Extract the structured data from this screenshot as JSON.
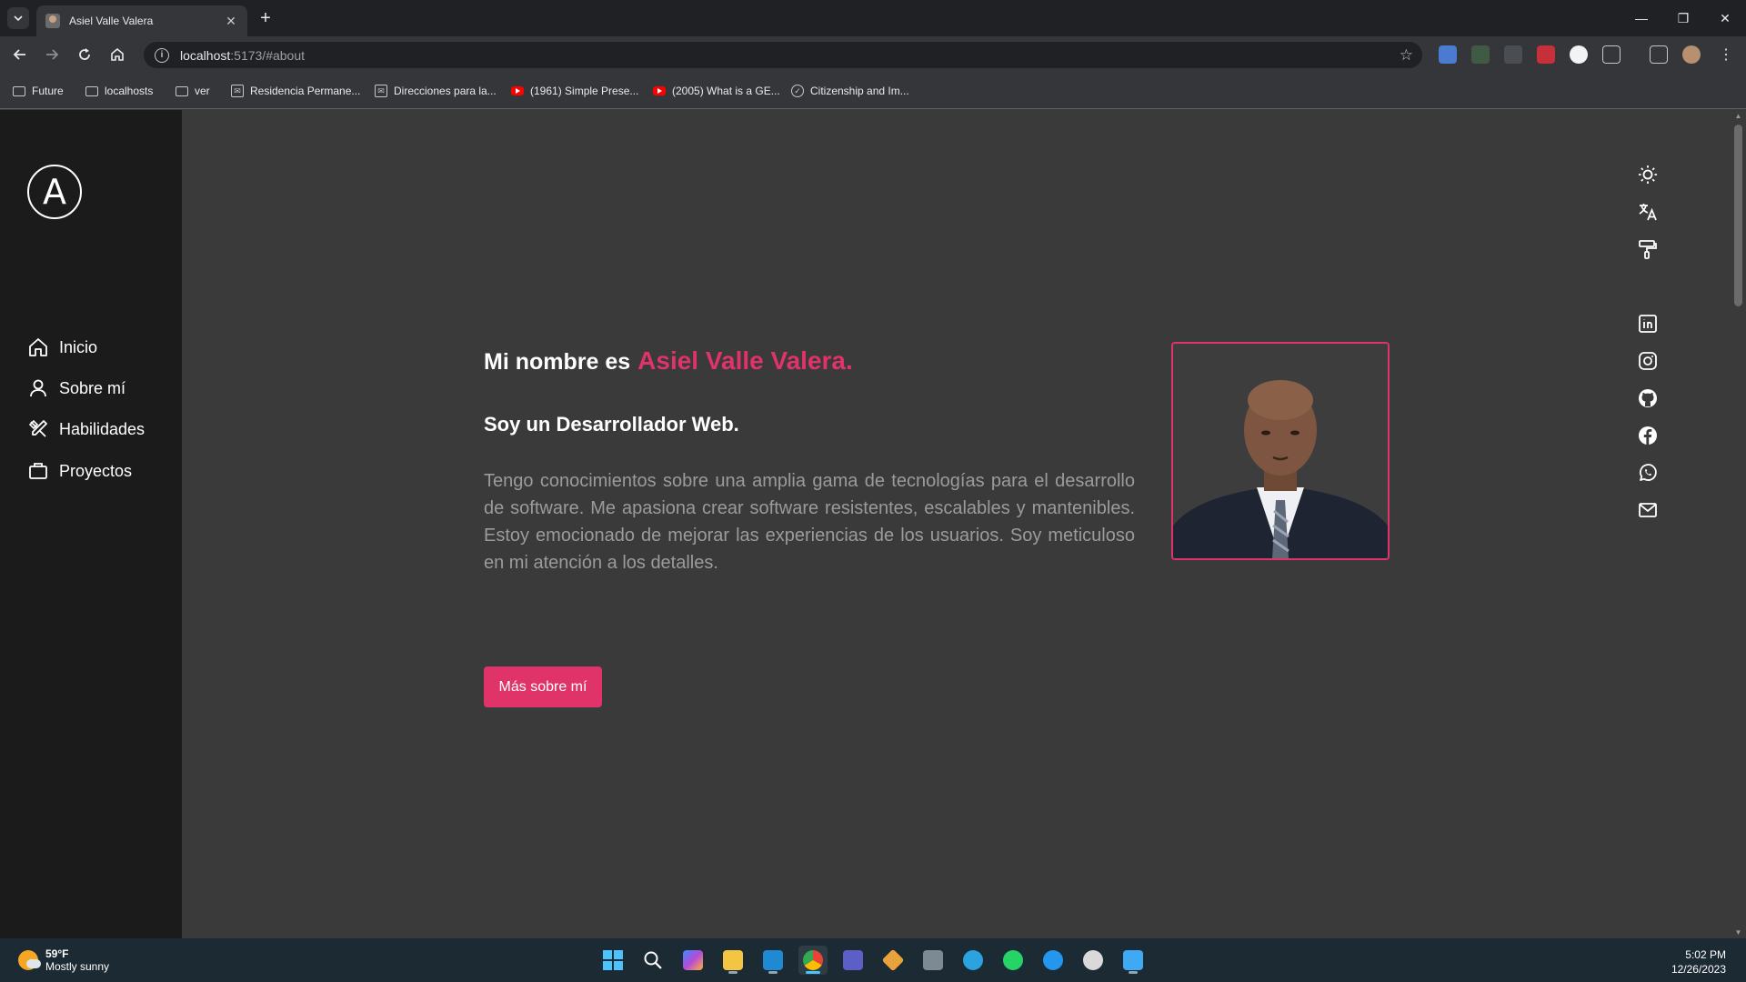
{
  "browser": {
    "tab_title": "Asiel Valle Valera",
    "url_host": "localhost",
    "url_path": ":5173/#about",
    "bookmarks": [
      {
        "label": "Future",
        "icon": "folder-icon"
      },
      {
        "label": "localhosts",
        "icon": "folder-icon"
      },
      {
        "label": "ver",
        "icon": "folder-icon"
      },
      {
        "label": "Residencia Permane...",
        "icon": "gov-site-icon"
      },
      {
        "label": "Direcciones para la...",
        "icon": "gov-site-icon"
      },
      {
        "label": "(1961) Simple Prese...",
        "icon": "youtube-icon"
      },
      {
        "label": "(2005) What is a GE...",
        "icon": "youtube-icon"
      },
      {
        "label": "Citizenship and Im...",
        "icon": "gov-site-icon"
      }
    ]
  },
  "sidebar": {
    "logo_letter": "A",
    "items": [
      {
        "label": "Inicio",
        "icon": "home-icon"
      },
      {
        "label": "Sobre mí",
        "icon": "user-icon"
      },
      {
        "label": "Habilidades",
        "icon": "tools-icon"
      },
      {
        "label": "Proyectos",
        "icon": "briefcase-icon"
      }
    ]
  },
  "about": {
    "intro": "Mi nombre es",
    "name": "Asiel Valle Valera.",
    "subtitle": "Soy un Desarrollador Web.",
    "description": "Tengo conocimientos sobre una amplia gama de tecnologías para el desarrollo de software. Me apasiona crear software resistentes, escalables y mantenibles. Estoy emocionado de mejorar las experiencias de los usuarios. Soy meticuloso en mi atención a los detalles.",
    "cta_label": "Más sobre mí"
  },
  "right_icons": [
    "sun-icon",
    "translate-icon",
    "paint-roller-icon",
    "linkedin-icon",
    "instagram-icon",
    "github-icon",
    "facebook-icon",
    "whatsapp-icon",
    "mail-icon"
  ],
  "taskbar": {
    "weather_temp": "59°F",
    "weather_desc": "Mostly sunny",
    "time": "5:02 PM",
    "date": "12/26/2023"
  },
  "colors": {
    "accent": "#e0336a",
    "sidebar_bg": "#1b1b1b",
    "page_bg": "#3a3a3a"
  }
}
